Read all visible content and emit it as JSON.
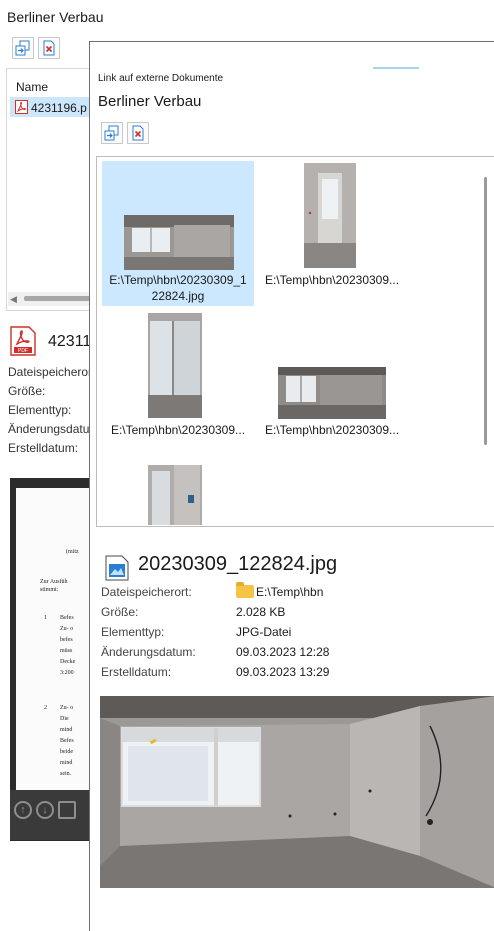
{
  "back_window": {
    "title": "Berliner Verbau",
    "list": {
      "column_name": "Name",
      "row_label": "4231196.p"
    },
    "details": {
      "file_name": "42311",
      "labels": [
        "Dateispeicheror",
        "Größe:",
        "Elementtyp:",
        "Änderungsdatu",
        "Erstelldatum:"
      ]
    },
    "preview_text": {
      "line1": "(mitz",
      "line2": "Zur Ausfüh",
      "line3": "stimmt:",
      "item1_num": "1",
      "item1_lines": [
        "Befes",
        "Zu- o",
        "befes",
        "müss",
        "Decke",
        "3:200"
      ],
      "item2_num": "2",
      "item2_lines": [
        "Zu- o",
        "Die",
        "mind",
        "Befes",
        "beide",
        "mind",
        "sein."
      ]
    }
  },
  "front_window": {
    "caption": "Link auf externe Dokumente",
    "title": "Berliner Verbau",
    "tiles": [
      {
        "caption_line1": "E:\\Temp\\hbn\\20230309_1",
        "caption_line2": "22824.jpg"
      },
      {
        "caption_line1": "E:\\Temp\\hbn\\20230309...",
        "caption_line2": ""
      },
      {
        "caption_line1": "E:\\Temp\\hbn\\20230309...",
        "caption_line2": ""
      },
      {
        "caption_line1": "E:\\Temp\\hbn\\20230309...",
        "caption_line2": ""
      },
      {
        "caption_line1": "",
        "caption_line2": ""
      }
    ],
    "details": {
      "file_name": "20230309_122824.jpg",
      "rows": [
        {
          "label": "Dateispeicherort:",
          "value": "E:\\Temp\\hbn"
        },
        {
          "label": "Größe:",
          "value": "2.028 KB"
        },
        {
          "label": "Elementtyp:",
          "value": "JPG-Datei"
        },
        {
          "label": "Änderungsdatum:",
          "value": "09.03.2023 12:28"
        },
        {
          "label": "Erstelldatum:",
          "value": "09.03.2023 13:29"
        }
      ]
    }
  },
  "icons": {
    "add_link": "add-link-icon",
    "remove_link": "remove-link-icon",
    "pdf": "pdf-file-icon",
    "image": "image-file-icon",
    "folder": "folder-icon",
    "preview_up": "arrow-up-icon",
    "preview_down": "arrow-down-icon"
  },
  "colors": {
    "selection": "#cce8ff",
    "pdf_red": "#d0302a",
    "folder_yellow": "#f5c345",
    "accent_blue": "#2a7fd4"
  }
}
